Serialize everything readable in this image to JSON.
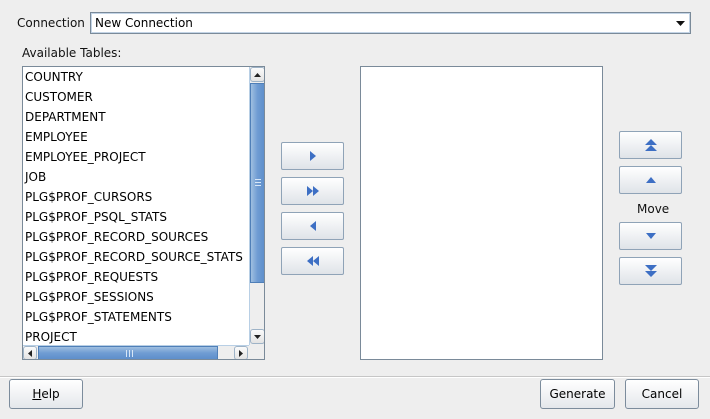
{
  "connection": {
    "label": "Connection",
    "selected": "New Connection"
  },
  "available_tables": {
    "label": "Available Tables:",
    "items": [
      "COUNTRY",
      "CUSTOMER",
      "DEPARTMENT",
      "EMPLOYEE",
      "EMPLOYEE_PROJECT",
      "JOB",
      "PLG$PROF_CURSORS",
      "PLG$PROF_PSQL_STATS",
      "PLG$PROF_RECORD_SOURCES",
      "PLG$PROF_RECORD_SOURCE_STATS",
      "PLG$PROF_REQUESTS",
      "PLG$PROF_SESSIONS",
      "PLG$PROF_STATEMENTS",
      "PROJECT"
    ]
  },
  "move": {
    "label": "Move"
  },
  "buttons": {
    "help_mnemonic": "H",
    "help_rest": "elp",
    "generate": "Generate",
    "cancel": "Cancel"
  },
  "colors": {
    "arrow_blue": "#3d6fc4",
    "scroll_thumb": "#6f9cd3",
    "background": "#eeeeee"
  },
  "icons": {
    "move_right": "triangle-right-icon",
    "move_all_right": "double-triangle-right-icon",
    "move_left": "triangle-left-icon",
    "move_all_left": "double-triangle-left-icon",
    "move_top": "double-triangle-up-icon",
    "move_up": "triangle-up-icon",
    "move_down": "triangle-down-icon",
    "move_bottom": "double-triangle-down-icon"
  }
}
